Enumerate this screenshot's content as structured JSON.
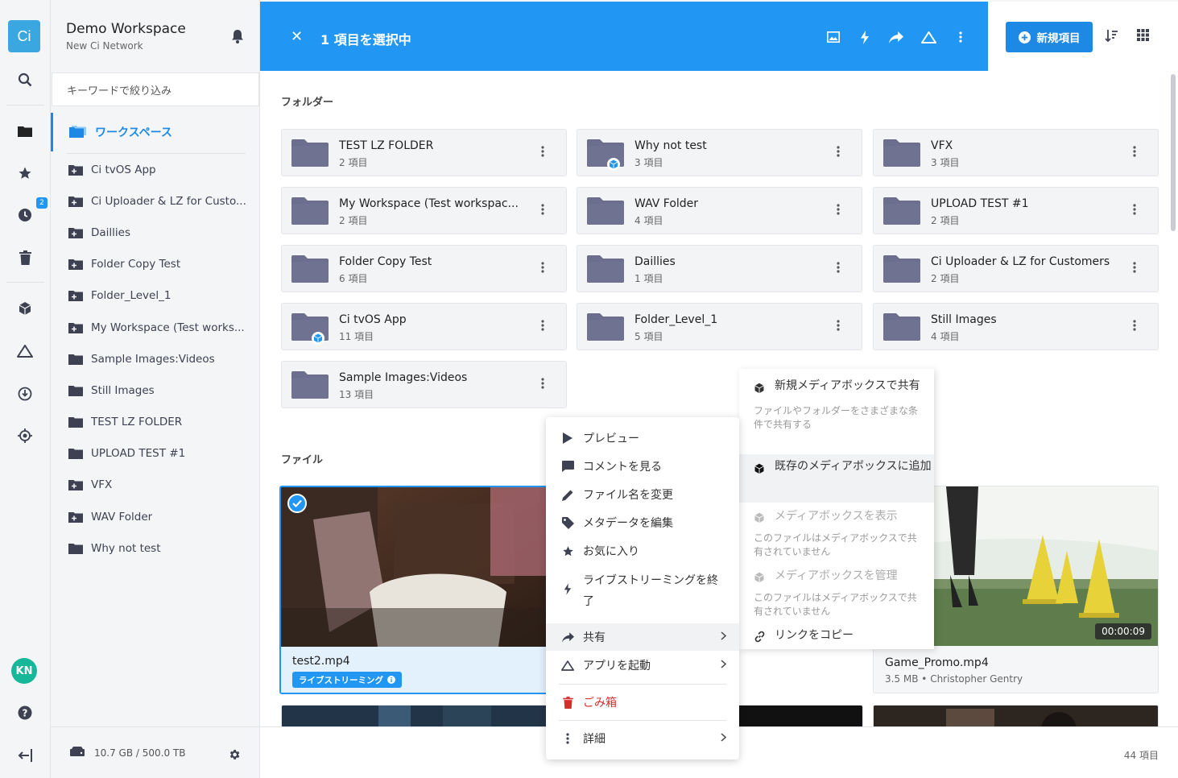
{
  "rail": {
    "logo": "Ci",
    "badge": "2",
    "avatar": "KN"
  },
  "sidebar": {
    "title": "Demo Workspace",
    "subtitle": "New Ci Network",
    "filter_placeholder": "キーワードで絞り込み",
    "root": "ワークスペース",
    "items": [
      {
        "label": "Ci tvOS App",
        "shared": true
      },
      {
        "label": "Ci Uploader & LZ for Custo...",
        "shared": true
      },
      {
        "label": "Daillies",
        "shared": true
      },
      {
        "label": "Folder Copy Test",
        "shared": true
      },
      {
        "label": "Folder_Level_1",
        "shared": true
      },
      {
        "label": "My Workspace (Test works...",
        "shared": true
      },
      {
        "label": "Sample Images:Videos",
        "shared": false
      },
      {
        "label": "Still Images",
        "shared": false
      },
      {
        "label": "TEST LZ FOLDER",
        "shared": false
      },
      {
        "label": "UPLOAD TEST #1",
        "shared": false
      },
      {
        "label": "VFX",
        "shared": true
      },
      {
        "label": "WAV Folder",
        "shared": true
      },
      {
        "label": "Why not test",
        "shared": false
      }
    ],
    "storage": "10.7 GB / 500.0 TB"
  },
  "header": {
    "selected": "1 項目を選択中",
    "new_item": "新規項目"
  },
  "main": {
    "folders_title": "フォルダー",
    "files_title": "ファイル",
    "folders": [
      {
        "name": "TEST LZ FOLDER",
        "count": "2 項目",
        "mediabox": false
      },
      {
        "name": "Why not test",
        "count": "3 項目",
        "mediabox": true
      },
      {
        "name": "VFX",
        "count": "3 項目",
        "mediabox": false
      },
      {
        "name": "My Workspace (Test workspac...",
        "count": "2 項目",
        "mediabox": false
      },
      {
        "name": "WAV Folder",
        "count": "4 項目",
        "mediabox": false
      },
      {
        "name": "UPLOAD TEST #1",
        "count": "2 項目",
        "mediabox": false
      },
      {
        "name": "Folder Copy Test",
        "count": "6 項目",
        "mediabox": false
      },
      {
        "name": "Daillies",
        "count": "1 項目",
        "mediabox": false
      },
      {
        "name": "Ci Uploader & LZ for Customers",
        "count": "2 項目",
        "mediabox": false
      },
      {
        "name": "Ci tvOS App",
        "count": "11 項目",
        "mediabox": true
      },
      {
        "name": "Folder_Level_1",
        "count": "5 項目",
        "mediabox": false
      },
      {
        "name": "Still Images",
        "count": "4 項目",
        "mediabox": false
      },
      {
        "name": "Sample Images:Videos",
        "count": "13 項目",
        "mediabox": false
      }
    ],
    "files": [
      {
        "name": "test2.mp4",
        "badge": "ライブストリーミング"
      },
      {
        "name": "Game_Promo.mp4",
        "meta": "3.5 MB • Christopher Gentry",
        "duration": "00:00:09"
      }
    ],
    "total": "44 項目"
  },
  "context_menu": {
    "preview": "プレビュー",
    "comments": "コメントを見る",
    "rename": "ファイル名を変更",
    "metadata": "メタデータを編集",
    "favorite": "お気に入り",
    "livestream": "ライブストリーミングを終了",
    "share": "共有",
    "launch_app": "アプリを起動",
    "trash": "ごみ箱",
    "details": "詳細"
  },
  "share_menu": {
    "new_mediabox": "新規メディアボックスで共有",
    "new_mediabox_desc": "ファイルやフォルダーをさまざまな条件で共有する",
    "add_existing": "既存のメディアボックスに追加",
    "show_mediabox": "メディアボックスを表示",
    "show_mediabox_desc": "このファイルはメディアボックスで共有されていません",
    "manage_mediabox": "メディアボックスを管理",
    "manage_mediabox_desc": "このファイルはメディアボックスで共有されていません",
    "copy_link": "リンクをコピー"
  },
  "colors": {
    "accent": "#2196f3",
    "folder": "#6b6e8c",
    "danger": "#d32f2f"
  }
}
